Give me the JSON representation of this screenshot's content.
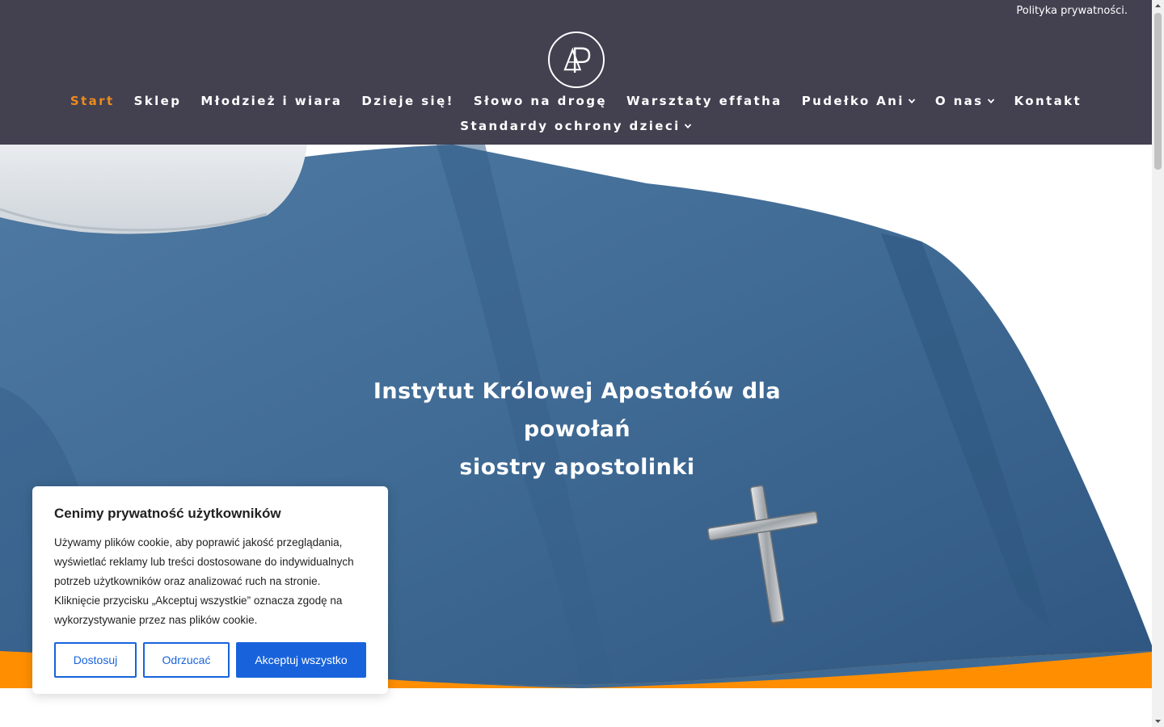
{
  "top_bar": {
    "privacy_link": "Polityka prywatności."
  },
  "nav": {
    "row1": [
      {
        "label": "Start",
        "active": true,
        "dropdown": false
      },
      {
        "label": "Sklep",
        "active": false,
        "dropdown": false
      },
      {
        "label": "Młodzież i wiara",
        "active": false,
        "dropdown": false
      },
      {
        "label": "Dzieje się!",
        "active": false,
        "dropdown": false
      },
      {
        "label": "Słowo na drogę",
        "active": false,
        "dropdown": false
      },
      {
        "label": "Warsztaty effatha",
        "active": false,
        "dropdown": false
      },
      {
        "label": "Pudełko Ani",
        "active": false,
        "dropdown": true
      },
      {
        "label": "O nas",
        "active": false,
        "dropdown": true
      },
      {
        "label": "Kontakt",
        "active": false,
        "dropdown": false
      }
    ],
    "row2": [
      {
        "label": "Standardy ochrony dzieci",
        "active": false,
        "dropdown": true
      }
    ]
  },
  "hero": {
    "title_lines": [
      "Instytut Królowej Apostołów dla",
      "powołań",
      "siostry apostolinki"
    ]
  },
  "cookie": {
    "title": "Cenimy prywatność użytkowników",
    "text": "Używamy plików cookie, aby poprawić jakość przeglądania, wyświetlać reklamy lub treści dostosowane do indywidualnych potrzeb użytkowników oraz analizować ruch na stronie. Kliknięcie przycisku „Akceptuj wszystkie” oznacza zgodę na wykorzystywanie przez nas plików cookie.",
    "customize_label": "Dostosuj",
    "reject_label": "Odrzucać",
    "accept_label": "Akceptuj wszystko"
  },
  "colors": {
    "header_bg": "#434050",
    "accent_orange": "#ee8b1a",
    "button_blue": "#1863dc",
    "habit_blue": "#3f6a94"
  },
  "icons": {
    "logo": "ap-monogram-logo",
    "dropdown": "chevron-down-icon"
  }
}
